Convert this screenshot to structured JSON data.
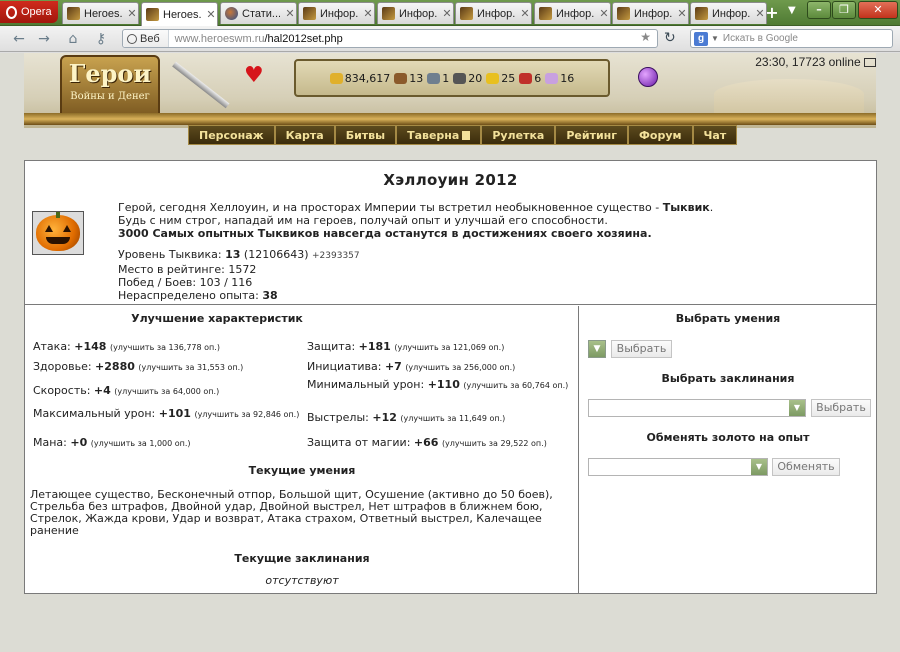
{
  "browser": {
    "opera_label": "Opera",
    "tabs": [
      {
        "label": "Heroes...",
        "icon": "heroes-favicon"
      },
      {
        "label": "Heroes...",
        "icon": "heroes-favicon"
      },
      {
        "label": "Стати...",
        "icon": "globe-favicon"
      },
      {
        "label": "Инфор...",
        "icon": "heroes-favicon"
      },
      {
        "label": "Инфор...",
        "icon": "heroes-favicon"
      },
      {
        "label": "Инфор...",
        "icon": "heroes-favicon"
      },
      {
        "label": "Инфор...",
        "icon": "heroes-favicon"
      },
      {
        "label": "Инфор...",
        "icon": "heroes-favicon"
      },
      {
        "label": "Инфор...",
        "icon": "heroes-favicon"
      }
    ],
    "active_tab_index": 1,
    "address": {
      "badge": "Веб",
      "domain": "www.heroeswm.ru",
      "path": "/hal2012set.php"
    },
    "search_placeholder": "Искать в Google"
  },
  "header": {
    "logo_title": "Герои",
    "logo_subtitle": "Войны и Денег",
    "resources": [
      "834,617",
      "13",
      "1",
      "20",
      "25",
      "6",
      "16"
    ],
    "resource_colors": [
      "#e0b02c",
      "#8b5a2b",
      "#6f7f8f",
      "#555555",
      "#e8c020",
      "#c0302a",
      "#c8a0e0"
    ],
    "status": "23:30, 17723 online",
    "menu": [
      "Персонаж",
      "Карта",
      "Битвы",
      "Таверна",
      "Рулетка",
      "Рейтинг",
      "Форум",
      "Чат"
    ]
  },
  "content": {
    "title": "Хэллоуин 2012",
    "desc_line1_a": "Герой, сегодня Хеллоуин, и на просторах Империи ты встретил необыкновенное существо - ",
    "desc_line1_b": "Тыквик",
    "desc_line1_c": ".",
    "desc_line2": "Будь с ним строг, нападай им на героев, получай опыт и улучшай его способности.",
    "desc_line3": "3000 Самых опытных Тыквиков навсегда останутся в достижениях своего хозяина.",
    "level_label": "Уровень Тыквика: ",
    "level_value": "13",
    "level_exp": " (12106643) ",
    "level_gain": "+2393357",
    "rating": "Место в рейтинге: 1572",
    "wins": "Побед / Боев: 103 / 116",
    "unspent_label": "Нераспределено опыта: ",
    "unspent_value": "38"
  },
  "improve": {
    "title": "Улучшение характеристик",
    "attrs": [
      {
        "label": "Атака: ",
        "value": "+148",
        "upg": "(улучшить за 136,778 оп.)"
      },
      {
        "label": "Защита: ",
        "value": "+181",
        "upg": "(улучшить за 121,069 оп.)"
      },
      {
        "label": "Здоровье: ",
        "value": "+2880",
        "upg": "(улучшить за 31,553 оп.)"
      },
      {
        "label": "Инициатива: ",
        "value": "+7",
        "upg": "(улучшить за 256,000 оп.)"
      },
      {
        "label": "Скорость: ",
        "value": "+4",
        "upg": "(улучшить за 64,000 оп.)"
      },
      {
        "label": "Минимальный урон: ",
        "value": "+110",
        "upg": "(улучшить за 60,764 оп.)"
      },
      {
        "label": "Максимальный урон: ",
        "value": "+101",
        "upg": "(улучшить за 92,846 оп.)"
      },
      {
        "label": "Выстрелы: ",
        "value": "+12",
        "upg": "(улучшить за 11,649 оп.)"
      },
      {
        "label": "Мана: ",
        "value": "+0",
        "upg": "(улучшить за 1,000 оп.)"
      },
      {
        "label": "Защита от магии: ",
        "value": "+66",
        "upg": "(улучшить за 29,522 оп.)"
      }
    ],
    "abilities_title": "Текущие умения",
    "abilities_text": "Летающее существо, Бесконечный отпор, Большой щит, Осушение (активно до 50 боев), Стрельба без штрафов, Двойной удар, Двойной выстрел, Нет штрафов в ближнем бою, Стрелок, Жажда крови, Удар и возврат, Атака страхом, Ответный выстрел, Калечащее ранение",
    "spells_title": "Текущие заклинания",
    "spells_empty": "отсутствуют"
  },
  "right": {
    "skill_title": "Выбрать умения",
    "skill_button": "Выбрать",
    "spell_title": "Выбрать заклинания",
    "spell_button": "Выбрать",
    "gold_title": "Обменять золото на опыт",
    "gold_button": "Обменять"
  }
}
